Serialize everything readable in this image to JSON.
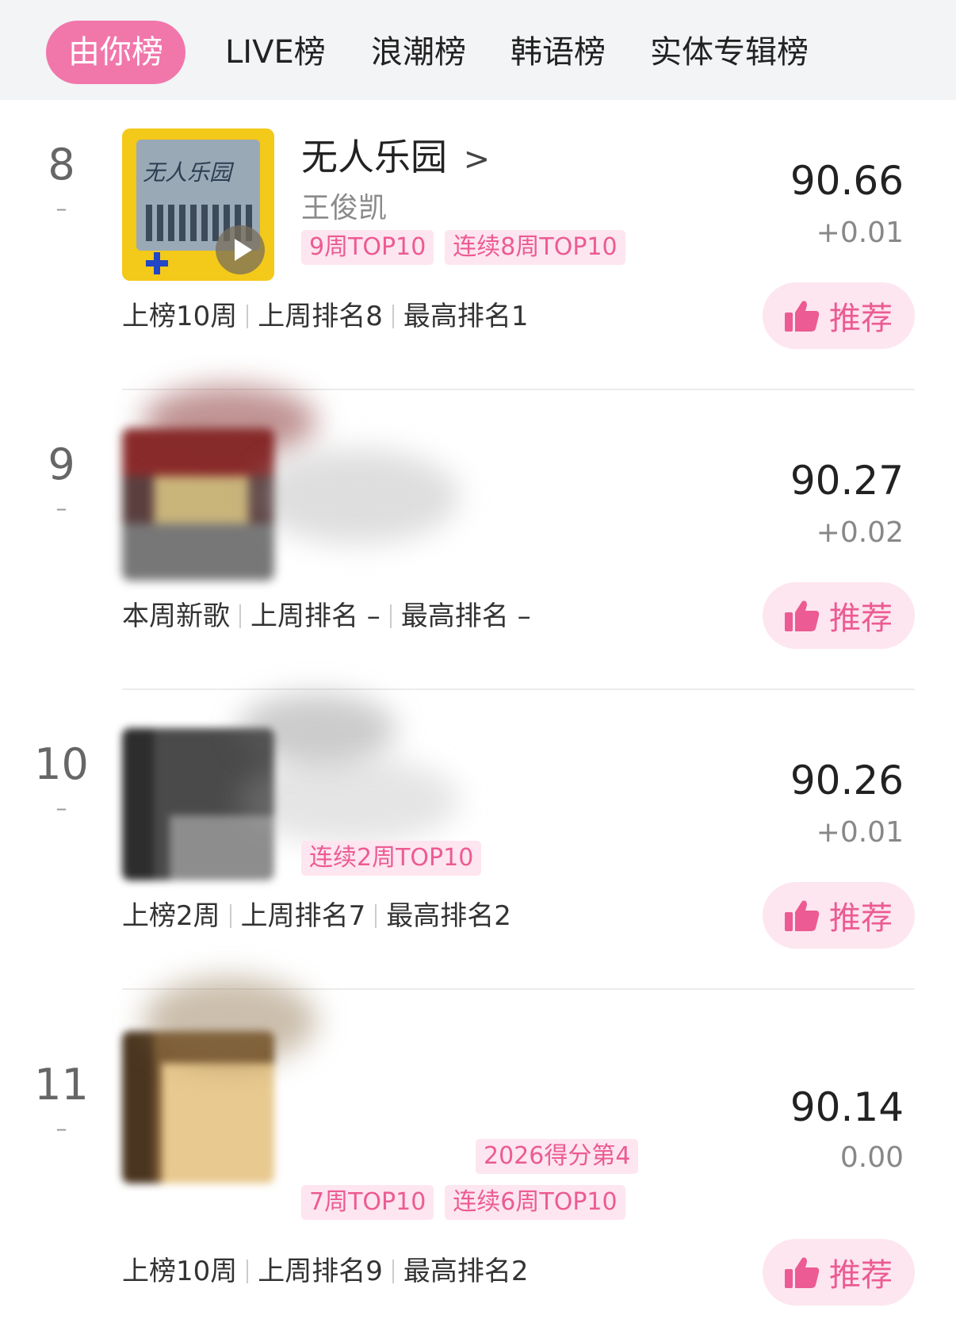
{
  "tabs": [
    {
      "label": "由你榜",
      "active": true
    },
    {
      "label": "LIVE榜",
      "active": false
    },
    {
      "label": "浪潮榜",
      "active": false
    },
    {
      "label": "韩语榜",
      "active": false
    },
    {
      "label": "实体专辑榜",
      "active": false
    }
  ],
  "entries": [
    {
      "rank": "8",
      "rank_change": "–",
      "title": "无人乐园",
      "title_chevron": ">",
      "artist": "王俊凯",
      "cover_text": "无人乐园",
      "badges": [
        "9周TOP10",
        "连续8周TOP10"
      ],
      "score": "90.66",
      "delta": "+0.01",
      "stats": [
        "上榜10周",
        "上周排名8",
        "最高排名1"
      ],
      "recommend_label": "推荐"
    },
    {
      "rank": "9",
      "rank_change": "–",
      "title": "",
      "artist": "",
      "badges": [],
      "score": "90.27",
      "delta": "+0.02",
      "stats": [
        "本周新歌",
        "上周排名 –",
        "最高排名 –"
      ],
      "recommend_label": "推荐"
    },
    {
      "rank": "10",
      "rank_change": "–",
      "title": "",
      "artist": "",
      "badges": [
        "连续2周TOP10"
      ],
      "score": "90.26",
      "delta": "+0.01",
      "stats": [
        "上榜2周",
        "上周排名7",
        "最高排名2"
      ],
      "recommend_label": "推荐"
    },
    {
      "rank": "11",
      "rank_change": "–",
      "title": "",
      "artist": "",
      "badges": [
        "2026得分第4",
        "7周TOP10",
        "连续6周TOP10"
      ],
      "score": "90.14",
      "delta": "0.00",
      "stats": [
        "上榜10周",
        "上周排名9",
        "最高排名2"
      ],
      "recommend_label": "推荐"
    }
  ],
  "colors": {
    "accent_pink": "#f177ab",
    "badge_text": "#ec5b93",
    "badge_bg": "#fde6ef",
    "tab_bar_bg": "#f2f4f6"
  }
}
